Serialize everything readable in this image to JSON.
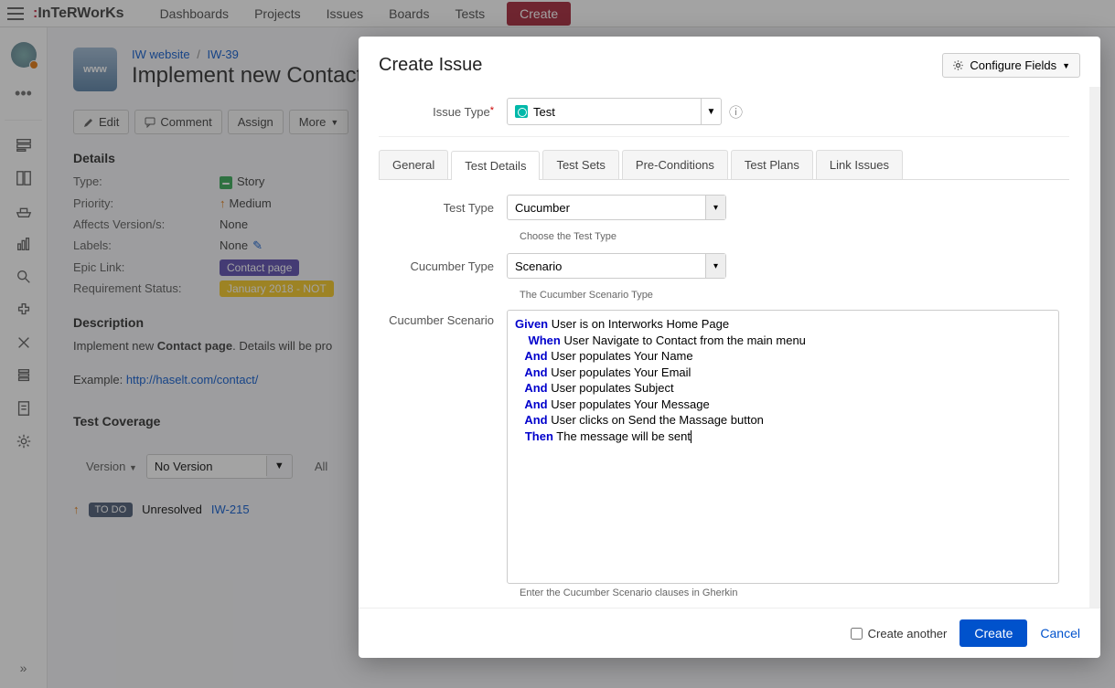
{
  "nav": {
    "logo_pre": "InTeR",
    "logo_post": "WorKs",
    "items": [
      "Dashboards",
      "Projects",
      "Issues",
      "Boards",
      "Tests"
    ],
    "create": "Create"
  },
  "breadcrumb": {
    "project": "IW website",
    "key": "IW-39"
  },
  "page": {
    "title": "Implement new Contact",
    "actions": {
      "edit": "Edit",
      "comment": "Comment",
      "assign": "Assign",
      "more": "More"
    },
    "details_h": "Details",
    "details": {
      "type_l": "Type:",
      "type_v": "Story",
      "priority_l": "Priority:",
      "priority_v": "Medium",
      "affects_l": "Affects Version/s:",
      "affects_v": "None",
      "labels_l": "Labels:",
      "labels_v": "None",
      "epic_l": "Epic Link:",
      "epic_v": "Contact page",
      "req_l": "Requirement Status:",
      "req_v": "January 2018 - NOT"
    },
    "desc_h": "Description",
    "desc_pre": "Implement new ",
    "desc_bold": "Contact page",
    "desc_post": ". Details will be pro",
    "example_l": "Example: ",
    "example_link": "http://haselt.com/contact/",
    "cov_h": "Test Coverage",
    "version_l": "Version",
    "version_v": "No Version",
    "all_l": "All",
    "row": {
      "status": "TO DO",
      "res": "Unresolved",
      "key": "IW-215"
    }
  },
  "dialog": {
    "title": "Create Issue",
    "configure": "Configure Fields",
    "issue_type_l": "Issue Type",
    "issue_type_v": "Test",
    "tabs": [
      "General",
      "Test Details",
      "Test Sets",
      "Pre-Conditions",
      "Test Plans",
      "Link Issues"
    ],
    "active_tab": 1,
    "test_type_l": "Test Type",
    "test_type_v": "Cucumber",
    "test_type_hint": "Choose the Test Type",
    "cuc_type_l": "Cucumber Type",
    "cuc_type_v": "Scenario",
    "cuc_type_hint": "The Cucumber Scenario Type",
    "scenario_l": "Cucumber Scenario",
    "scenario_lines": [
      {
        "kw": "Given",
        "txt": " User is on Interworks Home Page",
        "indent": 0
      },
      {
        "kw": "When",
        "txt": " User Navigate to Contact from the main menu",
        "indent": 4
      },
      {
        "kw": "And",
        "txt": " User populates Your Name",
        "indent": 3
      },
      {
        "kw": "And",
        "txt": " User populates Your Email",
        "indent": 3
      },
      {
        "kw": "And",
        "txt": " User populates Subject",
        "indent": 3
      },
      {
        "kw": "And",
        "txt": " User populates Your Message",
        "indent": 3
      },
      {
        "kw": "And",
        "txt": " User clicks on Send the Massage button",
        "indent": 3
      },
      {
        "kw": "Then",
        "txt": " The message will be sent",
        "indent": 3
      }
    ],
    "scenario_hint": "Enter the Cucumber Scenario clauses in Gherkin",
    "create_another": "Create another",
    "submit": "Create",
    "cancel": "Cancel"
  }
}
